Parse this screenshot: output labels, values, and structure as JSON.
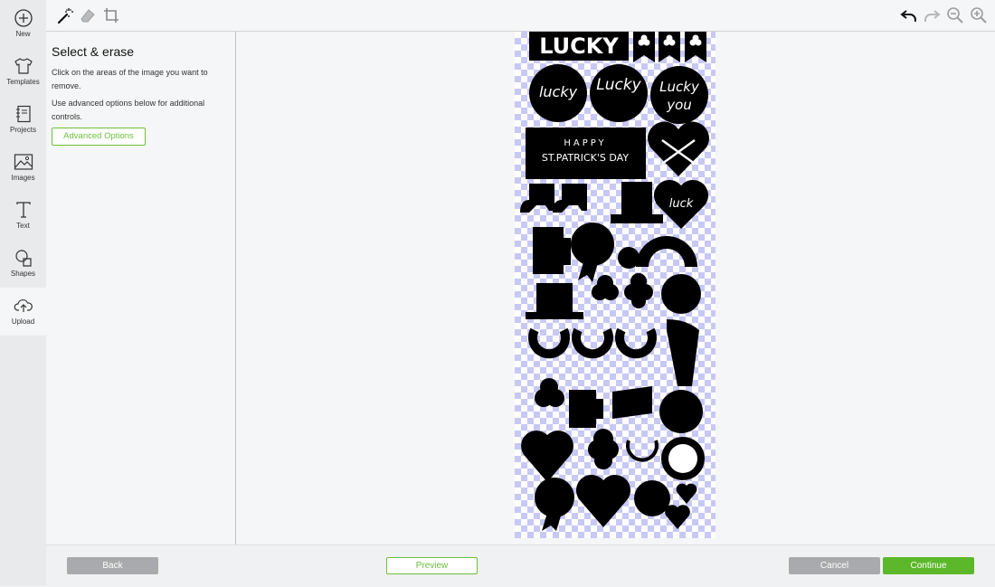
{
  "nav": {
    "items": [
      {
        "label": "New",
        "icon": "plus-circle-icon"
      },
      {
        "label": "Templates",
        "icon": "tshirt-icon"
      },
      {
        "label": "Projects",
        "icon": "notebook-icon"
      },
      {
        "label": "Images",
        "icon": "image-icon"
      },
      {
        "label": "Text",
        "icon": "text-icon"
      },
      {
        "label": "Shapes",
        "icon": "shapes-icon"
      },
      {
        "label": "Upload",
        "icon": "cloud-upload-icon"
      }
    ],
    "active": "Upload"
  },
  "toolbar": {
    "tools": [
      "magic-wand-icon",
      "eraser-icon",
      "crop-icon"
    ],
    "actions": [
      "undo-icon",
      "redo-icon",
      "zoom-out-icon",
      "zoom-in-icon"
    ]
  },
  "panel": {
    "title": "Select & erase",
    "instructions": "Click on the areas of the image you want to remove.",
    "advanced_hint": "Use advanced options below for additional controls.",
    "advanced_button": "Advanced Options"
  },
  "canvas": {
    "image_text": {
      "lucky_banner": "LUCKY",
      "badge1": "lucky",
      "badge2": "Lucky",
      "badge3_line1": "Lucky",
      "badge3_line2": "you",
      "sign_line1": "HAPPY",
      "sign_line2": "ST.PATRICK'S DAY",
      "heart_text": "luck"
    }
  },
  "footer": {
    "back": "Back",
    "preview": "Preview",
    "cancel": "Cancel",
    "continue": "Continue"
  },
  "colors": {
    "accent": "#5cb82a",
    "accent_outline": "#6dbf3a",
    "checker": "#c8c8f5",
    "disabled": "#a8aaad"
  }
}
